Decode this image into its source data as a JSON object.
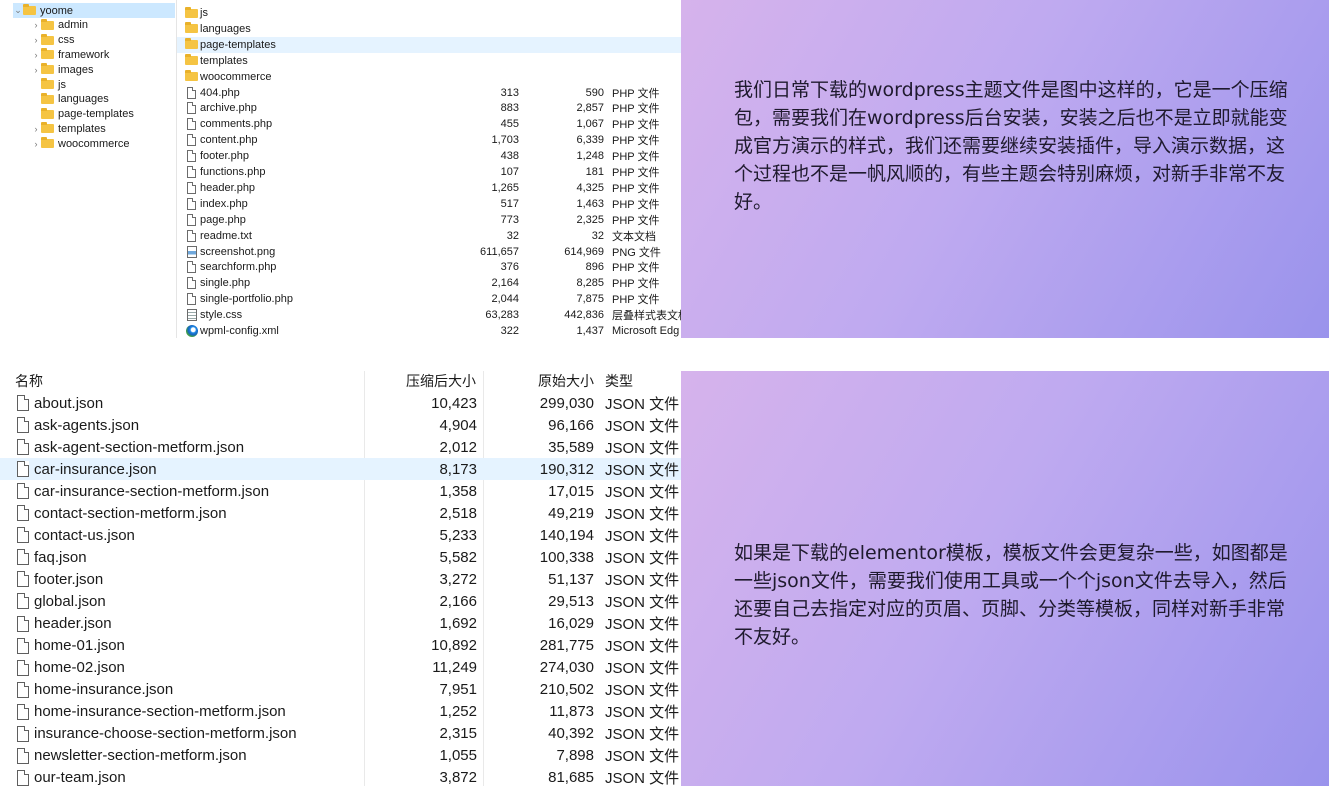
{
  "top_explorer": {
    "tree": [
      {
        "label": "yoome",
        "expandable": true,
        "expanded": true,
        "selected": true
      },
      {
        "label": "admin",
        "expandable": true
      },
      {
        "label": "css",
        "expandable": true
      },
      {
        "label": "framework",
        "expandable": true
      },
      {
        "label": "images",
        "expandable": true
      },
      {
        "label": "js",
        "expandable": false
      },
      {
        "label": "languages",
        "expandable": false
      },
      {
        "label": "page-templates",
        "expandable": false
      },
      {
        "label": "templates",
        "expandable": true
      },
      {
        "label": "woocommerce",
        "expandable": true
      }
    ],
    "files": [
      {
        "icon": "folder-icon",
        "name": "js",
        "compressed": "",
        "original": "",
        "type": ""
      },
      {
        "icon": "folder-icon",
        "name": "languages",
        "compressed": "",
        "original": "",
        "type": ""
      },
      {
        "icon": "folder-icon",
        "name": "page-templates",
        "compressed": "",
        "original": "",
        "type": "",
        "highlighted": true
      },
      {
        "icon": "folder-icon",
        "name": "templates",
        "compressed": "",
        "original": "",
        "type": ""
      },
      {
        "icon": "folder-icon",
        "name": "woocommerce",
        "compressed": "",
        "original": "",
        "type": ""
      },
      {
        "icon": "file-icon",
        "name": "404.php",
        "compressed": "313",
        "original": "590",
        "type": "PHP 文件"
      },
      {
        "icon": "file-icon",
        "name": "archive.php",
        "compressed": "883",
        "original": "2,857",
        "type": "PHP 文件"
      },
      {
        "icon": "file-icon",
        "name": "comments.php",
        "compressed": "455",
        "original": "1,067",
        "type": "PHP 文件"
      },
      {
        "icon": "file-icon",
        "name": "content.php",
        "compressed": "1,703",
        "original": "6,339",
        "type": "PHP 文件"
      },
      {
        "icon": "file-icon",
        "name": "footer.php",
        "compressed": "438",
        "original": "1,248",
        "type": "PHP 文件"
      },
      {
        "icon": "file-icon",
        "name": "functions.php",
        "compressed": "107",
        "original": "181",
        "type": "PHP 文件"
      },
      {
        "icon": "file-icon",
        "name": "header.php",
        "compressed": "1,265",
        "original": "4,325",
        "type": "PHP 文件"
      },
      {
        "icon": "file-icon",
        "name": "index.php",
        "compressed": "517",
        "original": "1,463",
        "type": "PHP 文件"
      },
      {
        "icon": "file-icon",
        "name": "page.php",
        "compressed": "773",
        "original": "2,325",
        "type": "PHP 文件"
      },
      {
        "icon": "file-icon",
        "name": "readme.txt",
        "compressed": "32",
        "original": "32",
        "type": "文本文档"
      },
      {
        "icon": "image-file-icon",
        "name": "screenshot.png",
        "compressed": "611,657",
        "original": "614,969",
        "type": "PNG 文件"
      },
      {
        "icon": "file-icon",
        "name": "searchform.php",
        "compressed": "376",
        "original": "896",
        "type": "PHP 文件"
      },
      {
        "icon": "file-icon",
        "name": "single.php",
        "compressed": "2,164",
        "original": "8,285",
        "type": "PHP 文件"
      },
      {
        "icon": "file-icon",
        "name": "single-portfolio.php",
        "compressed": "2,044",
        "original": "7,875",
        "type": "PHP 文件"
      },
      {
        "icon": "stylesheet-file-icon",
        "name": "style.css",
        "compressed": "63,283",
        "original": "442,836",
        "type": "层叠样式表文档"
      },
      {
        "icon": "edge-browser-icon",
        "name": "wpml-config.xml",
        "compressed": "322",
        "original": "1,437",
        "type": "Microsoft Edg"
      }
    ]
  },
  "top_panel": {
    "text": "我们日常下载的wordpress主题文件是图中这样的，它是一个压缩包，需要我们在wordpress后台安装，安装之后也不是立即就能变成官方演示的样式，我们还需要继续安装插件，导入演示数据，这个过程也不是一帆风顺的，有些主题会特别麻烦，对新手非常不友好。"
  },
  "bottom_explorer": {
    "headers": {
      "name": "名称",
      "compressed": "压缩后大小",
      "original": "原始大小",
      "type": "类型"
    },
    "files": [
      {
        "name": "about.json",
        "compressed": "10,423",
        "original": "299,030",
        "type": "JSON 文件"
      },
      {
        "name": "ask-agents.json",
        "compressed": "4,904",
        "original": "96,166",
        "type": "JSON 文件"
      },
      {
        "name": "ask-agent-section-metform.json",
        "compressed": "2,012",
        "original": "35,589",
        "type": "JSON 文件"
      },
      {
        "name": "car-insurance.json",
        "compressed": "8,173",
        "original": "190,312",
        "type": "JSON 文件",
        "highlighted": true
      },
      {
        "name": "car-insurance-section-metform.json",
        "compressed": "1,358",
        "original": "17,015",
        "type": "JSON 文件"
      },
      {
        "name": "contact-section-metform.json",
        "compressed": "2,518",
        "original": "49,219",
        "type": "JSON 文件"
      },
      {
        "name": "contact-us.json",
        "compressed": "5,233",
        "original": "140,194",
        "type": "JSON 文件"
      },
      {
        "name": "faq.json",
        "compressed": "5,582",
        "original": "100,338",
        "type": "JSON 文件"
      },
      {
        "name": "footer.json",
        "compressed": "3,272",
        "original": "51,137",
        "type": "JSON 文件"
      },
      {
        "name": "global.json",
        "compressed": "2,166",
        "original": "29,513",
        "type": "JSON 文件"
      },
      {
        "name": "header.json",
        "compressed": "1,692",
        "original": "16,029",
        "type": "JSON 文件"
      },
      {
        "name": "home-01.json",
        "compressed": "10,892",
        "original": "281,775",
        "type": "JSON 文件"
      },
      {
        "name": "home-02.json",
        "compressed": "11,249",
        "original": "274,030",
        "type": "JSON 文件"
      },
      {
        "name": "home-insurance.json",
        "compressed": "7,951",
        "original": "210,502",
        "type": "JSON 文件"
      },
      {
        "name": "home-insurance-section-metform.json",
        "compressed": "1,252",
        "original": "11,873",
        "type": "JSON 文件"
      },
      {
        "name": "insurance-choose-section-metform.json",
        "compressed": "2,315",
        "original": "40,392",
        "type": "JSON 文件"
      },
      {
        "name": "newsletter-section-metform.json",
        "compressed": "1,055",
        "original": "7,898",
        "type": "JSON 文件"
      },
      {
        "name": "our-team.json",
        "compressed": "3,872",
        "original": "81,685",
        "type": "JSON 文件"
      }
    ]
  },
  "bottom_panel": {
    "text": "如果是下载的elementor模板，模板文件会更复杂一些，如图都是一些json文件，需要我们使用工具或一个个json文件去导入，然后还要自己去指定对应的页眉、页脚、分类等模板，同样对新手非常不友好。"
  },
  "colors": {
    "folder": "#f5c443",
    "selection": "#cce8ff",
    "row_highlight": "#e5f3ff",
    "panel_gradient_start": "#d6b3ec",
    "panel_gradient_end": "#9a93ec"
  }
}
